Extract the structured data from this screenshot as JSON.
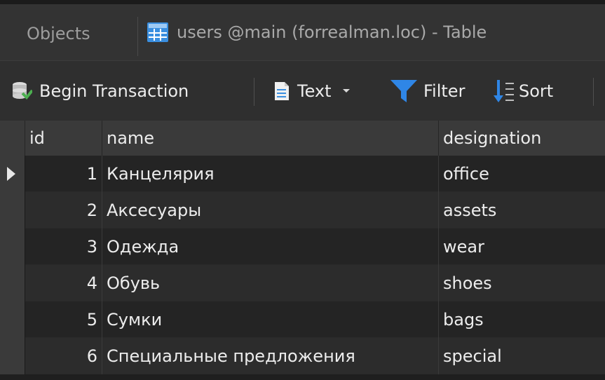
{
  "tabs": {
    "objects_label": "Objects",
    "table_tab_label": "users @main (forrealman.loc) - Table"
  },
  "toolbar": {
    "begin_transaction_label": "Begin Transaction",
    "text_label": "Text",
    "filter_label": "Filter",
    "sort_label": "Sort"
  },
  "grid": {
    "columns": [
      "id",
      "name",
      "designation"
    ],
    "rows": [
      {
        "id": "1",
        "name": "Канцелярия",
        "designation": "office"
      },
      {
        "id": "2",
        "name": "Аксесуары",
        "designation": "assets"
      },
      {
        "id": "3",
        "name": "Одежда",
        "designation": "wear"
      },
      {
        "id": "4",
        "name": "Обувь",
        "designation": "shoes"
      },
      {
        "id": "5",
        "name": "Сумки",
        "designation": "bags"
      },
      {
        "id": "6",
        "name": "Специальные предложения",
        "designation": "special"
      }
    ]
  },
  "colors": {
    "accent_blue": "#3a8fe0",
    "filter_blue": "#2f86e6"
  }
}
